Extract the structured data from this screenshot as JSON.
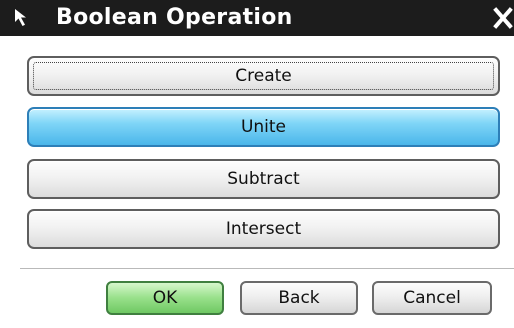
{
  "window": {
    "title": "Boolean Operation",
    "grip_icon": "arrow-cursor-icon",
    "close_icon": "close-icon"
  },
  "operations": [
    {
      "label": "Create",
      "state": "focused"
    },
    {
      "label": "Unite",
      "state": "selected"
    },
    {
      "label": "Subtract",
      "state": "normal"
    },
    {
      "label": "Intersect",
      "state": "normal"
    }
  ],
  "actions": {
    "ok_label": "OK",
    "back_label": "Back",
    "cancel_label": "Cancel"
  },
  "colors": {
    "titlebar": "#1c1c1c",
    "selected_button": "#7fd5f7",
    "ok_button": "#98e08a"
  }
}
